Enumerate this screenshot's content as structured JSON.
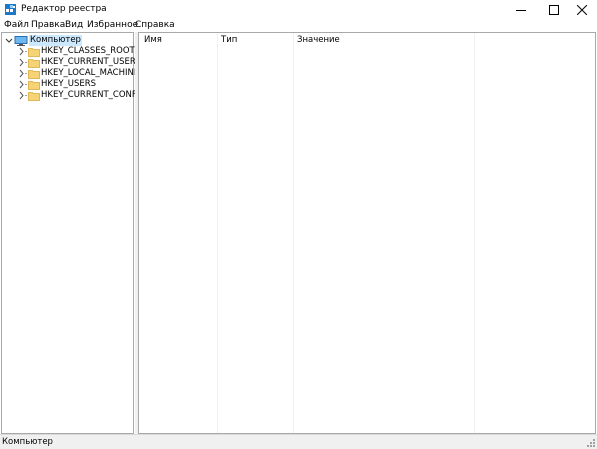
{
  "window": {
    "title": "Редактор реестра",
    "icon": "registry-editor-icon"
  },
  "menu": {
    "items": [
      "Файл",
      "Правка",
      "Вид",
      "Избранное",
      "Справка"
    ]
  },
  "tree": {
    "root_label": "Компьютер",
    "keys": [
      {
        "label": "HKEY_CLASSES_ROOT"
      },
      {
        "label": "HKEY_CURRENT_USER"
      },
      {
        "label": "HKEY_LOCAL_MACHINE"
      },
      {
        "label": "HKEY_USERS"
      },
      {
        "label": "HKEY_CURRENT_CONFIG"
      }
    ]
  },
  "list": {
    "columns": [
      "Имя",
      "Тип",
      "Значение"
    ]
  },
  "status": {
    "path": "Компьютер"
  },
  "colors": {
    "selection": "#cce8ff",
    "folder": "#f6d374",
    "border": "#a9a9a9",
    "statusbar": "#f0f0f0"
  }
}
